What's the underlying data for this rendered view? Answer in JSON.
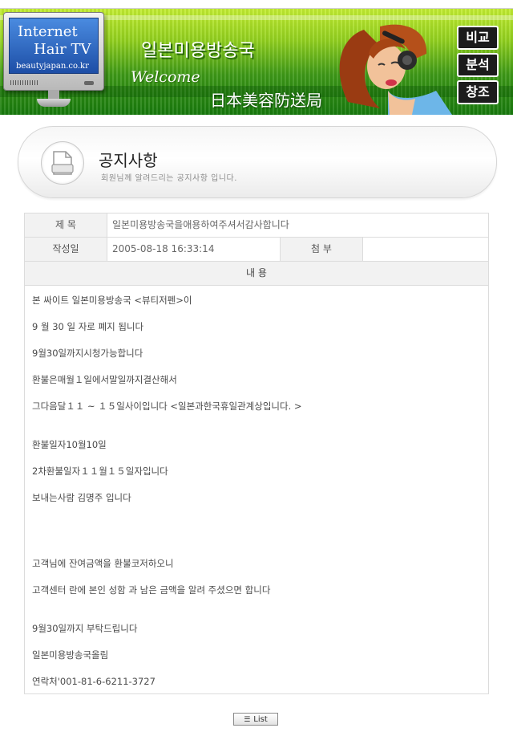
{
  "banner": {
    "monitor": {
      "line1": "Internet",
      "line2": "Hair TV",
      "url": "beautyjapan.co.kr"
    },
    "title_ko": "일본미용방송국",
    "welcome": "Welcome",
    "title_jp": "日本美容防送局",
    "side_buttons": [
      "비교",
      "분석",
      "창조"
    ]
  },
  "notice": {
    "title": "공지사항",
    "subtitle": "회원님께 알려드리는 공지사항 입니다.",
    "icon": "document-icon"
  },
  "post": {
    "subject_label": "제 목",
    "subject": "일본미용방송국을애용하여주셔서감사합니다",
    "date_label": "작성일",
    "date": "2005-08-18 16:33:14",
    "attach_label": "첨 부",
    "attach": "",
    "content_label": "내 용",
    "lines": [
      "본 싸이트 일본미용방송국 <뷰티저펜>이",
      "9 월 30 일 자로 폐지 됩니다",
      "9월30일까지시청가능합니다",
      "환불은매월１일에서말일까지결산해서",
      "그다음달１１ ~ １５일사이입니다 <일본과한국휴일관계상입니다. >",
      "환불일자10월10일",
      "2차환불일자１１월１５일자입니다",
      "보내는사람 김명주 입니다",
      "고객님에 잔여금액을 환불코저하오니",
      "고객센터 란에 본인 성함 과 남은 금액을 알려 주셨으면 합니다",
      "9월30일까지 부탁드립니다",
      "일본미용방송국올림",
      "연락처'001-81-6-6211-3727"
    ]
  },
  "list_button": {
    "label": "List",
    "icon": "list-icon"
  }
}
